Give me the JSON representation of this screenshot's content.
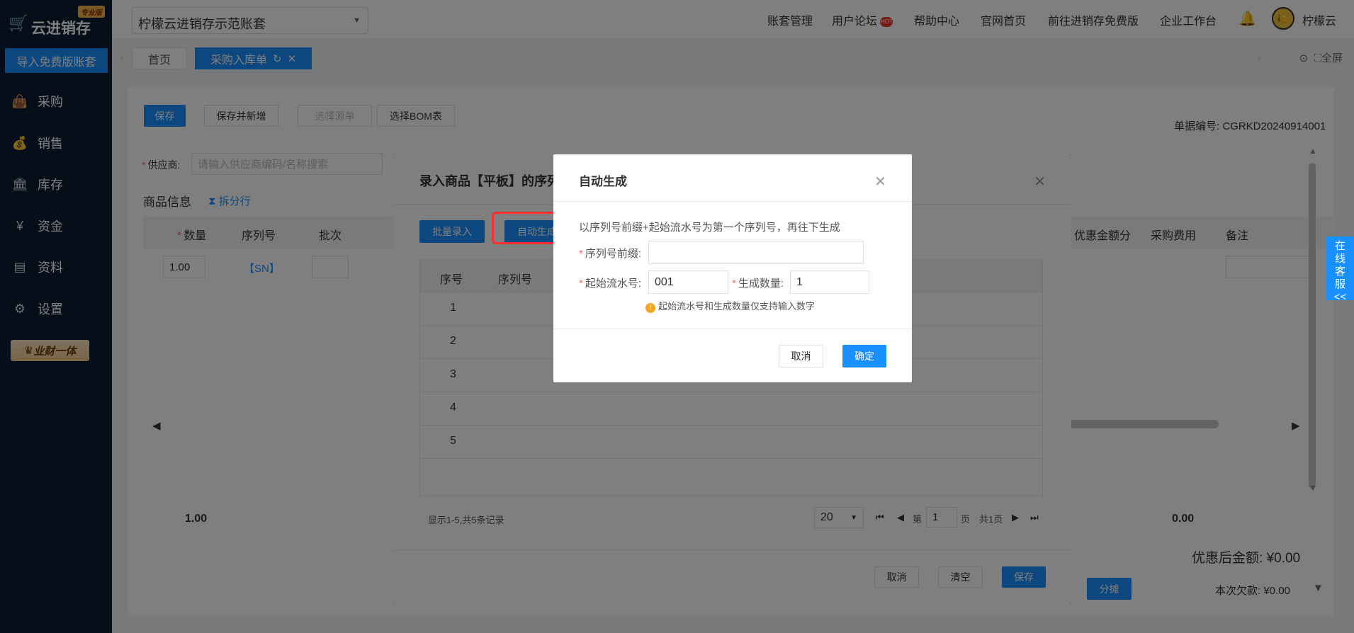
{
  "sidebar": {
    "logo_text": "云进销存",
    "logo_badge": "专业版",
    "import_button": "导入免费版账套",
    "items": [
      {
        "label": "采购",
        "icon": "bag-icon"
      },
      {
        "label": "销售",
        "icon": "sale-icon"
      },
      {
        "label": "库存",
        "icon": "warehouse-icon"
      },
      {
        "label": "资金",
        "icon": "yen-icon"
      },
      {
        "label": "资料",
        "icon": "document-icon"
      },
      {
        "label": "设置",
        "icon": "gear-icon"
      }
    ],
    "vip_label": "业财一体"
  },
  "topbar": {
    "account": "柠檬云进销存示范账套",
    "links": [
      "账套管理",
      "用户论坛",
      "帮助中心",
      "官网首页",
      "前往进销存免费版",
      "企业工作台"
    ],
    "hot_badge": "HOT",
    "username": "柠檬云"
  },
  "tabs": {
    "home": "首页",
    "active": "采购入库单",
    "fullscreen": "全屏"
  },
  "page": {
    "buttons": {
      "save": "保存",
      "save_new": "保存并新增",
      "select_source": "选择源单",
      "select_bom": "选择BOM表"
    },
    "doc_no_label": "单据编号:",
    "doc_no": "CGRKD20240914001",
    "supplier_label": "供应商:",
    "supplier_placeholder": "请输入供应商编码/名称搜索",
    "section_title": "商品信息",
    "split_row": "拆分行",
    "table_headers": [
      "数量",
      "序列号",
      "批次",
      "优惠金额分",
      "采购费用",
      "备注"
    ],
    "row": {
      "qty": "1.00",
      "sn": "【SN】"
    },
    "total_qty": "1.00",
    "total_right": "0.00",
    "discount_label": "优惠后金额:",
    "discount_value": "¥0.00",
    "allocate": "分摊",
    "debt_label": "本次欠款:",
    "debt_value": "¥0.00"
  },
  "dialog_serial": {
    "title": "录入商品【平板】的序列",
    "batch_btn": "批量录入",
    "auto_btn": "自动生成",
    "headers": [
      "序号",
      "序列号"
    ],
    "rows": [
      "1",
      "2",
      "3",
      "4",
      "5"
    ],
    "record_info": "显示1-5,共5条记录",
    "page_size": "20",
    "page_prefix": "第",
    "page_num": "1",
    "page_suffix": "页",
    "total_pages": "共1页",
    "cancel": "取消",
    "clear": "清空",
    "save": "保存"
  },
  "dialog_auto": {
    "title": "自动生成",
    "desc": "以序列号前缀+起始流水号为第一个序列号，再往下生成",
    "prefix_label": "序列号前缀:",
    "prefix_value": "",
    "start_label": "起始流水号:",
    "start_value": "001",
    "count_label": "生成数量:",
    "count_value": "1",
    "hint": "起始流水号和生成数量仅支持输入数字",
    "cancel": "取消",
    "confirm": "确定"
  },
  "chat": {
    "label": "在线客服",
    "arrow": "<<"
  }
}
